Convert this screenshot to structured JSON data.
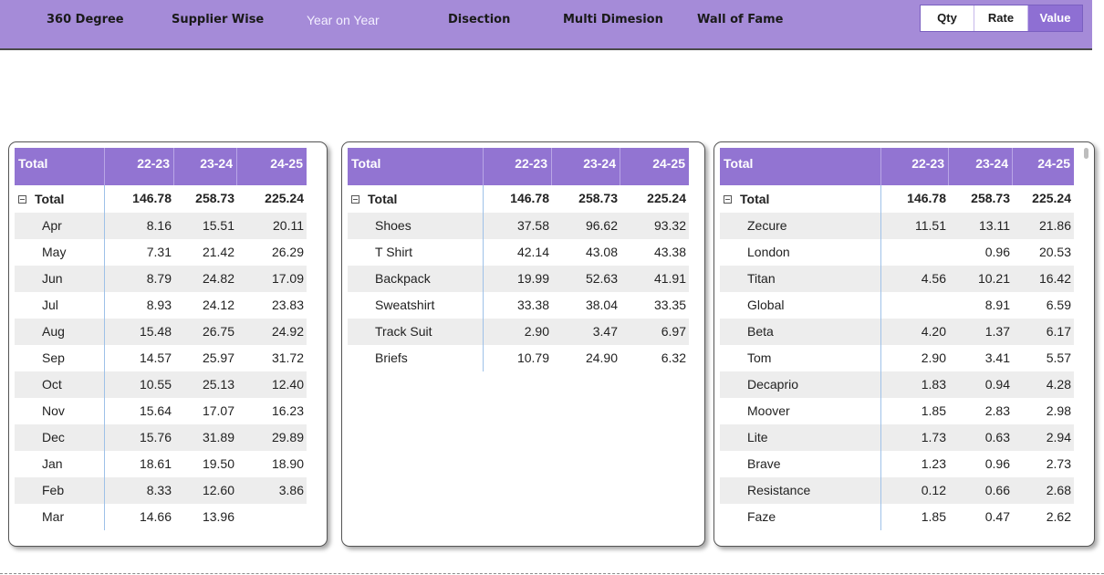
{
  "nav": {
    "items": [
      "360 Degree",
      "Supplier Wise",
      "Year on Year",
      "Disection",
      "Multi Dimesion",
      "Wall of Fame"
    ],
    "active": "Year on Year"
  },
  "measure_toggle": {
    "options": [
      "Qty",
      "Rate",
      "Value"
    ],
    "selected": "Value"
  },
  "colors": {
    "header": "#9274d2",
    "topbar": "#a58bd8"
  },
  "tables": [
    {
      "header": [
        "Total",
        "22-23",
        "23-24",
        "24-25"
      ],
      "total": [
        "Total",
        "146.78",
        "258.73",
        "225.24"
      ],
      "rows": [
        [
          "Apr",
          "8.16",
          "15.51",
          "20.11"
        ],
        [
          "May",
          "7.31",
          "21.42",
          "26.29"
        ],
        [
          "Jun",
          "8.79",
          "24.82",
          "17.09"
        ],
        [
          "Jul",
          "8.93",
          "24.12",
          "23.83"
        ],
        [
          "Aug",
          "15.48",
          "26.75",
          "24.92"
        ],
        [
          "Sep",
          "14.57",
          "25.97",
          "31.72"
        ],
        [
          "Oct",
          "10.55",
          "25.13",
          "12.40"
        ],
        [
          "Nov",
          "15.64",
          "17.07",
          "16.23"
        ],
        [
          "Dec",
          "15.76",
          "31.89",
          "29.89"
        ],
        [
          "Jan",
          "18.61",
          "19.50",
          "18.90"
        ],
        [
          "Feb",
          "8.33",
          "12.60",
          "3.86"
        ],
        [
          "Mar",
          "14.66",
          "13.96",
          ""
        ]
      ]
    },
    {
      "header": [
        "Total",
        "22-23",
        "23-24",
        "24-25"
      ],
      "total": [
        "Total",
        "146.78",
        "258.73",
        "225.24"
      ],
      "rows": [
        [
          "Shoes",
          "37.58",
          "96.62",
          "93.32"
        ],
        [
          "T Shirt",
          "42.14",
          "43.08",
          "43.38"
        ],
        [
          "Backpack",
          "19.99",
          "52.63",
          "41.91"
        ],
        [
          "Sweatshirt",
          "33.38",
          "38.04",
          "33.35"
        ],
        [
          "Track Suit",
          "2.90",
          "3.47",
          "6.97"
        ],
        [
          "Briefs",
          "10.79",
          "24.90",
          "6.32"
        ]
      ]
    },
    {
      "header": [
        "Total",
        "22-23",
        "23-24",
        "24-25"
      ],
      "total": [
        "Total",
        "146.78",
        "258.73",
        "225.24"
      ],
      "rows": [
        [
          "Zecure",
          "11.51",
          "13.11",
          "21.86"
        ],
        [
          "London",
          "",
          "0.96",
          "20.53"
        ],
        [
          "Titan",
          "4.56",
          "10.21",
          "16.42"
        ],
        [
          "Global",
          "",
          "8.91",
          "6.59"
        ],
        [
          "Beta",
          "4.20",
          "1.37",
          "6.17"
        ],
        [
          "Tom",
          "2.90",
          "3.41",
          "5.57"
        ],
        [
          "Decaprio",
          "1.83",
          "0.94",
          "4.28"
        ],
        [
          "Moover",
          "1.85",
          "2.83",
          "2.98"
        ],
        [
          "Lite",
          "1.73",
          "0.63",
          "2.94"
        ],
        [
          "Brave",
          "1.23",
          "0.96",
          "2.73"
        ],
        [
          "Resistance",
          "0.12",
          "0.66",
          "2.68"
        ],
        [
          "Faze",
          "1.85",
          "0.47",
          "2.62"
        ]
      ]
    }
  ]
}
